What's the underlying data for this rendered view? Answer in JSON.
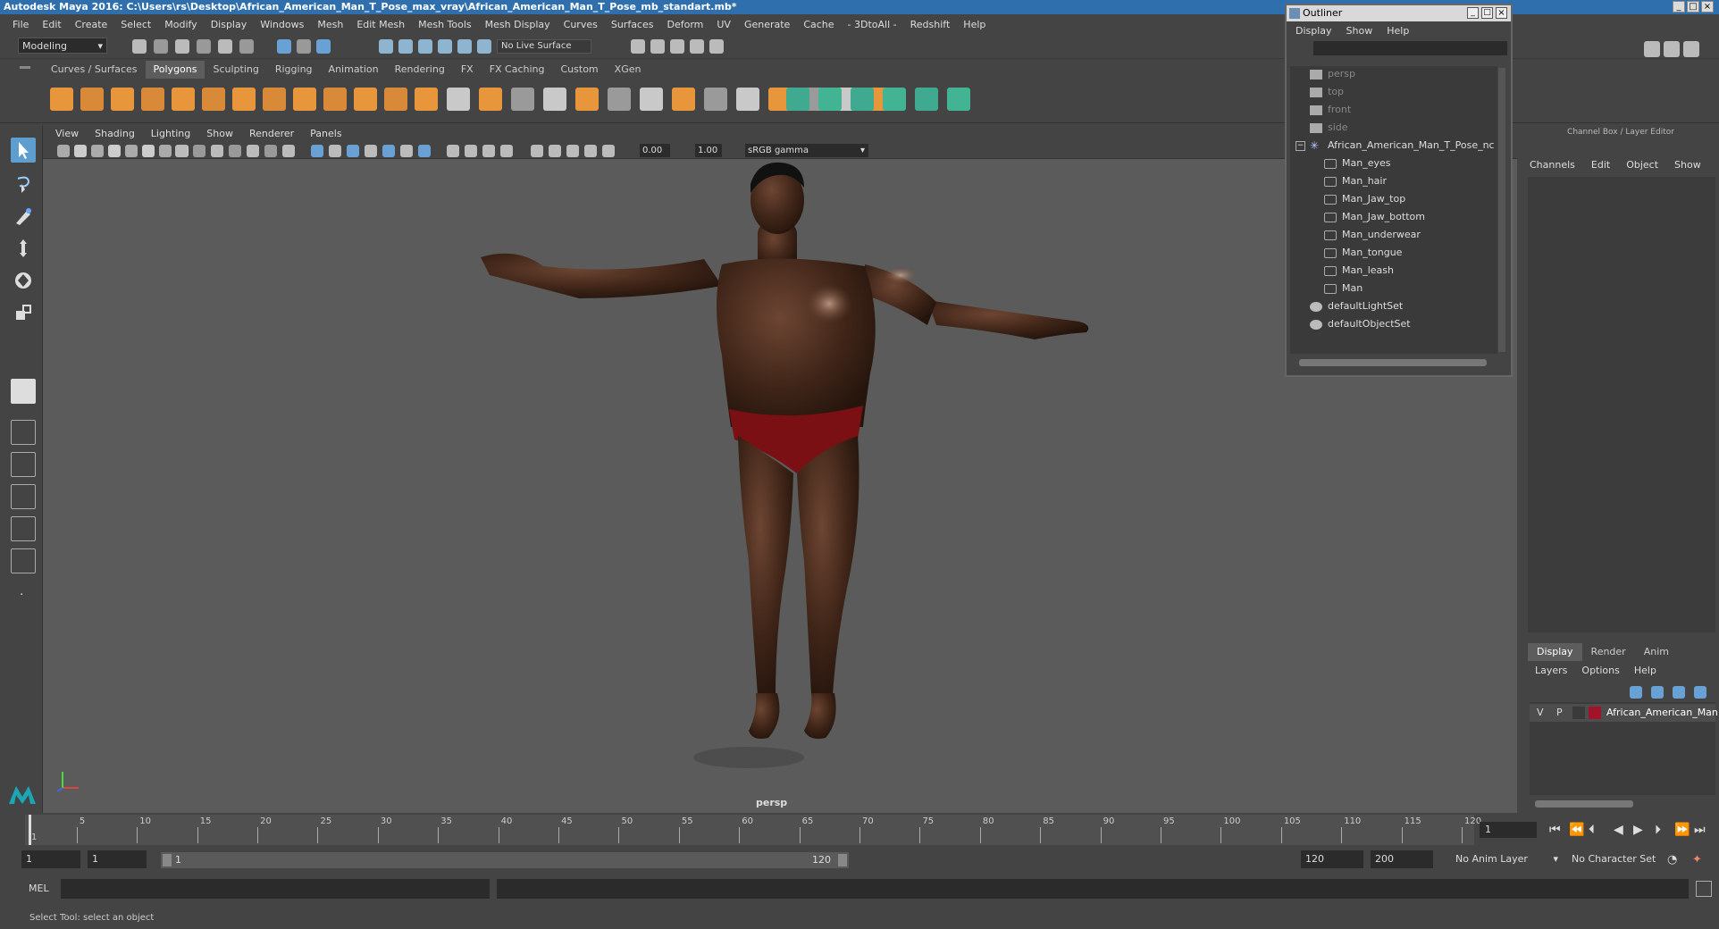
{
  "window": {
    "title": "Autodesk Maya 2016: C:\\Users\\rs\\Desktop\\African_American_Man_T_Pose_max_vray\\African_American_Man_T_Pose_mb_standart.mb*"
  },
  "menubar": [
    "File",
    "Edit",
    "Create",
    "Select",
    "Modify",
    "Display",
    "Windows",
    "Mesh",
    "Edit Mesh",
    "Mesh Tools",
    "Mesh Display",
    "Curves",
    "Surfaces",
    "Deform",
    "UV",
    "Generate",
    "Cache",
    "- 3DtoAll -",
    "Redshift",
    "Help"
  ],
  "status_line": {
    "mode": "Modeling",
    "live_surface": "No Live Surface"
  },
  "shelf_tabs": {
    "items": [
      "Curves / Surfaces",
      "Polygons",
      "Sculpting",
      "Rigging",
      "Animation",
      "Rendering",
      "FX",
      "FX Caching",
      "Custom",
      "XGen"
    ],
    "active": "Polygons"
  },
  "panel_menu": [
    "View",
    "Shading",
    "Lighting",
    "Show",
    "Renderer",
    "Panels"
  ],
  "panel_toolbar": {
    "exposure": "0.00",
    "gamma": "1.00",
    "color_space": "sRGB gamma"
  },
  "viewport": {
    "camera_label": "persp"
  },
  "outliner": {
    "title": "Outliner",
    "menu": [
      "Display",
      "Show",
      "Help"
    ],
    "items": [
      {
        "label": "persp",
        "type": "camera",
        "indent": 0
      },
      {
        "label": "top",
        "type": "camera",
        "indent": 0
      },
      {
        "label": "front",
        "type": "camera",
        "indent": 0
      },
      {
        "label": "side",
        "type": "camera",
        "indent": 0
      },
      {
        "label": "African_American_Man_T_Pose_nc",
        "type": "group",
        "indent": 0
      },
      {
        "label": "Man_eyes",
        "type": "mesh",
        "indent": 1
      },
      {
        "label": "Man_hair",
        "type": "mesh",
        "indent": 1
      },
      {
        "label": "Man_Jaw_top",
        "type": "mesh",
        "indent": 1
      },
      {
        "label": "Man_Jaw_bottom",
        "type": "mesh",
        "indent": 1
      },
      {
        "label": "Man_underwear",
        "type": "mesh",
        "indent": 1
      },
      {
        "label": "Man_tongue",
        "type": "mesh",
        "indent": 1
      },
      {
        "label": "Man_leash",
        "type": "mesh",
        "indent": 1
      },
      {
        "label": "Man",
        "type": "mesh",
        "indent": 1
      },
      {
        "label": "defaultLightSet",
        "type": "set",
        "indent": 0
      },
      {
        "label": "defaultObjectSet",
        "type": "set",
        "indent": 0
      }
    ]
  },
  "channel_box": {
    "header": "Channel Box / Layer Editor",
    "menu": [
      "Channels",
      "Edit",
      "Object",
      "Show"
    ],
    "layer_tabs": {
      "items": [
        "Display",
        "Render",
        "Anim"
      ],
      "active": "Display"
    },
    "layer_menu": [
      "Layers",
      "Options",
      "Help"
    ],
    "layer": {
      "v": "V",
      "p": "P",
      "name": "African_American_Man",
      "color": "#a0132a"
    }
  },
  "timeline": {
    "ticks": [
      1,
      5,
      10,
      15,
      20,
      25,
      30,
      35,
      40,
      45,
      50,
      55,
      60,
      65,
      70,
      75,
      80,
      85,
      90,
      95,
      100,
      105,
      110,
      115,
      120
    ],
    "max": 120,
    "current_frame": "1"
  },
  "range": {
    "start": "1",
    "playback_start": "1",
    "slider_start": "1",
    "slider_end": "120",
    "playback_end": "120",
    "end": "200",
    "anim_layer": "No Anim Layer",
    "character_set": "No Character Set"
  },
  "command_line": {
    "label": "MEL"
  },
  "help_line": "Select Tool: select an object",
  "colors": {
    "accent": "#5d9ecf",
    "title_bar": "#2f6fae",
    "viewport_bg": "#5b5b5b",
    "layer_red": "#a0132a"
  }
}
